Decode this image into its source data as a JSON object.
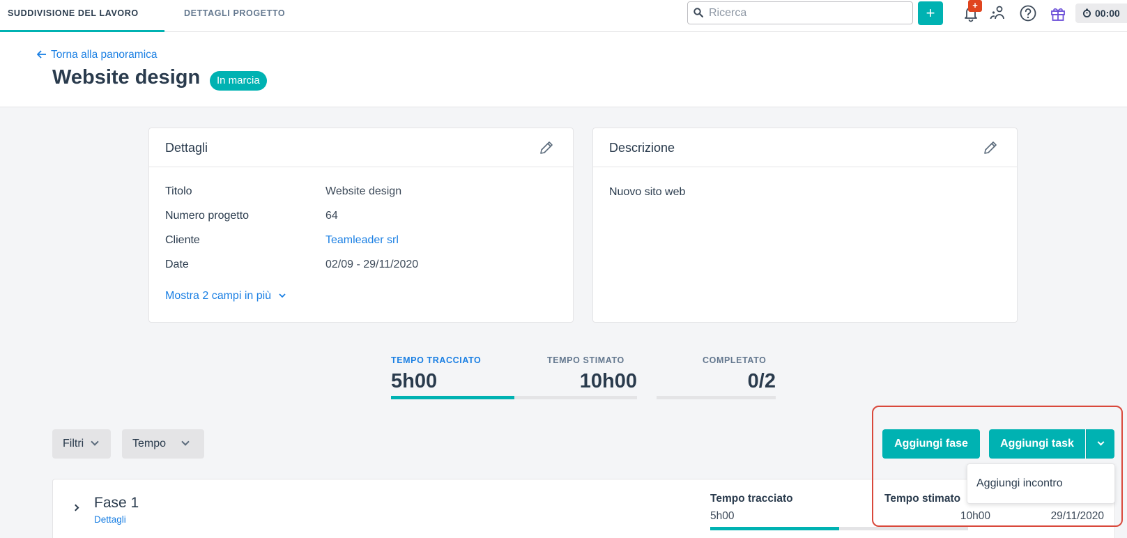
{
  "nav": {
    "tabs": [
      {
        "label": "SUDDIVISIONE DEL LAVORO",
        "active": true
      },
      {
        "label": "DETTAGLI PROGETTO",
        "active": false
      }
    ],
    "search_placeholder": "Ricerca",
    "add_label": "+",
    "notification_badge": "+",
    "timer": "00:00",
    "icons": [
      "search-icon",
      "bell-icon",
      "people-icon",
      "help-icon",
      "gift-icon",
      "stopwatch-icon"
    ]
  },
  "header": {
    "back_link": "Torna alla panoramica",
    "title": "Website design",
    "status": "In marcia"
  },
  "details_card": {
    "title": "Dettagli",
    "rows": [
      {
        "label": "Titolo",
        "value": "Website design"
      },
      {
        "label": "Numero progetto",
        "value": "64"
      },
      {
        "label": "Cliente",
        "value": "Teamleader srl"
      },
      {
        "label": "Date",
        "value": "02/09 - 29/11/2020"
      }
    ],
    "more_link": "Mostra 2 campi in più"
  },
  "description_card": {
    "title": "Descrizione",
    "text": "Nuovo sito web"
  },
  "stats": {
    "tracked_label": "TEMPO TRACCIATO",
    "tracked_value": "5h00",
    "estimated_label": "TEMPO STIMATO",
    "estimated_value": "10h00",
    "tracked_progress": 0.5,
    "completed_label": "COMPLETATO",
    "completed_value": "0/2",
    "completed_progress": 0
  },
  "filters": {
    "filters_label": "Filtri",
    "time_label": "Tempo"
  },
  "actions": {
    "add_phase": "Aggiungi fase",
    "add_task": "Aggiungi task",
    "dropdown_item": "Aggiungi incontro"
  },
  "phase": {
    "name": "Fase 1",
    "details_link": "Dettagli",
    "tracked_head": "Tempo tracciato",
    "tracked_value": "5h00",
    "estimated_head": "Tempo stimato",
    "estimated_value": "10h00",
    "end_date": "29/11/2020",
    "tracked_progress": 0.5
  },
  "colors": {
    "accent": "#00b2b2",
    "link": "#1a7fe3",
    "highlight": "#d9483b",
    "badge_red": "#e0451f"
  }
}
